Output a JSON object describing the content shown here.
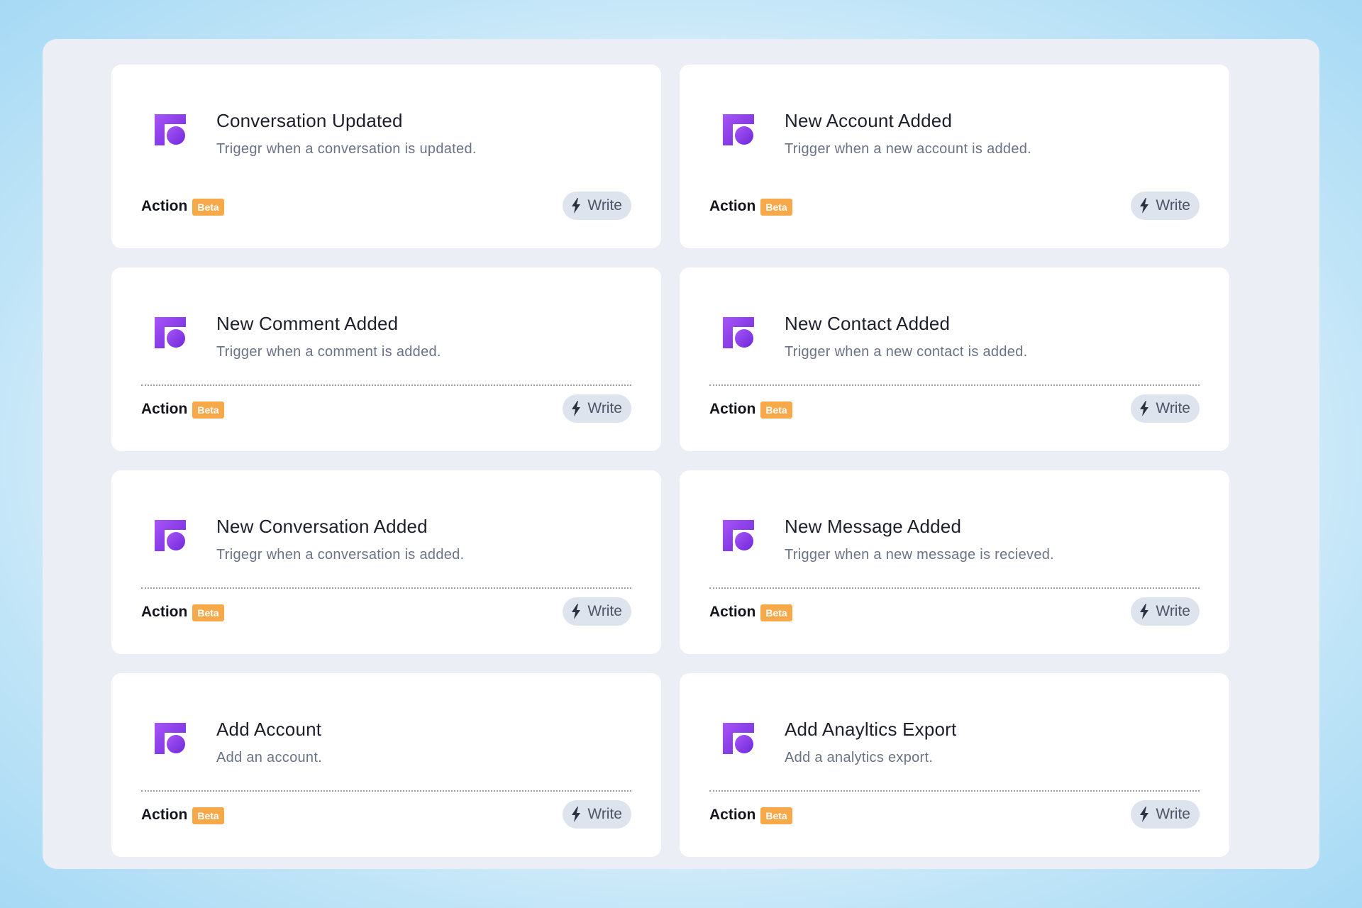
{
  "colors": {
    "logo_primary": "#7c3aed",
    "logo_secondary": "#a855f7",
    "beta_badge": "#f7a94a",
    "write_button_bg": "#dde4ee"
  },
  "cards": [
    {
      "title": "Conversation Updated",
      "description": "Trigegr when a conversation is updated.",
      "action_label": "Action",
      "badge": "Beta",
      "button_label": "Write",
      "button_icon": "lightning-icon",
      "logo_icon": "app-logo-icon",
      "has_divider": false
    },
    {
      "title": "New Account Added",
      "description": "Trigger when a new account is added.",
      "action_label": "Action",
      "badge": "Beta",
      "button_label": "Write",
      "button_icon": "lightning-icon",
      "logo_icon": "app-logo-icon",
      "has_divider": false
    },
    {
      "title": "New Comment Added",
      "description": "Trigger when a comment is added.",
      "action_label": "Action",
      "badge": "Beta",
      "button_label": "Write",
      "button_icon": "lightning-icon",
      "logo_icon": "app-logo-icon",
      "has_divider": true
    },
    {
      "title": "New Contact Added",
      "description": "Trigger when a new contact is added.",
      "action_label": "Action",
      "badge": "Beta",
      "button_label": "Write",
      "button_icon": "lightning-icon",
      "logo_icon": "app-logo-icon",
      "has_divider": true
    },
    {
      "title": "New Conversation Added",
      "description": "Trigegr when a conversation is added.",
      "action_label": "Action",
      "badge": "Beta",
      "button_label": "Write",
      "button_icon": "lightning-icon",
      "logo_icon": "app-logo-icon",
      "has_divider": true
    },
    {
      "title": "New Message Added",
      "description": "Trigger when a new message is recieved.",
      "action_label": "Action",
      "badge": "Beta",
      "button_label": "Write",
      "button_icon": "lightning-icon",
      "logo_icon": "app-logo-icon",
      "has_divider": true
    },
    {
      "title": "Add Account",
      "description": "Add an account.",
      "action_label": "Action",
      "badge": "Beta",
      "button_label": "Write",
      "button_icon": "lightning-icon",
      "logo_icon": "app-logo-icon",
      "has_divider": true
    },
    {
      "title": "Add Anayltics Export",
      "description": "Add a analytics export.",
      "action_label": "Action",
      "badge": "Beta",
      "button_label": "Write",
      "button_icon": "lightning-icon",
      "logo_icon": "app-logo-icon",
      "has_divider": true
    }
  ]
}
